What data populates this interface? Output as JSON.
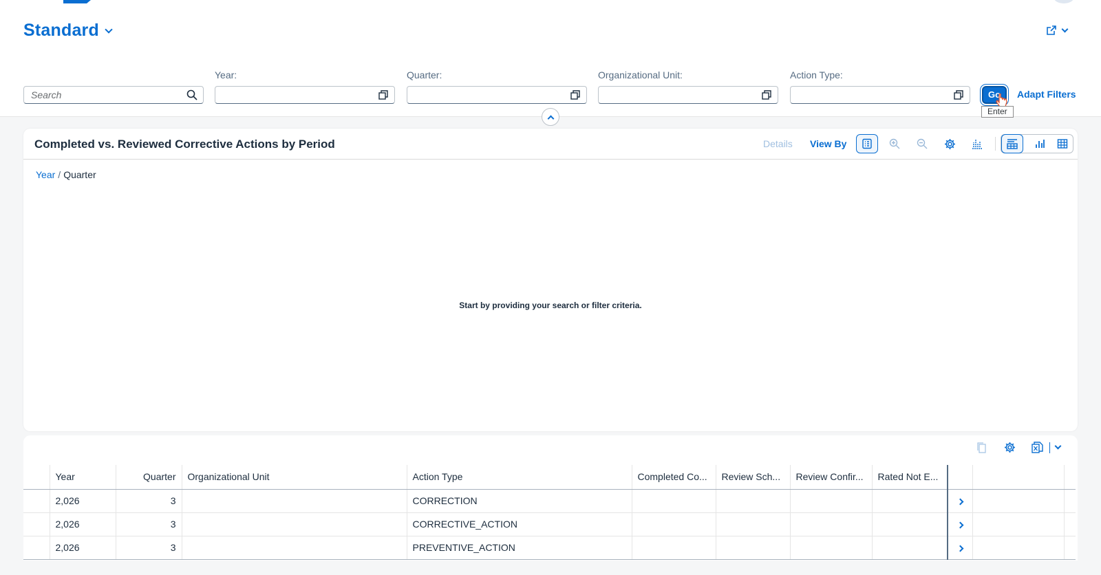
{
  "header": {
    "variant_title": "Standard",
    "filters": {
      "search_placeholder": "Search",
      "year_label": "Year:",
      "quarter_label": "Quarter:",
      "org_unit_label": "Organizational Unit:",
      "action_type_label": "Action Type:",
      "go_label": "Go",
      "go_tooltip": "Enter",
      "adapt_label": "Adapt Filters"
    }
  },
  "chart": {
    "title": "Completed vs. Reviewed Corrective Actions by Period",
    "details_label": "Details",
    "view_by_label": "View By",
    "breadcrumb": {
      "link": "Year",
      "separator": "/",
      "current": "Quarter"
    },
    "empty_message": "Start by providing your search or filter criteria."
  },
  "table": {
    "columns": [
      "Year",
      "Quarter",
      "Organizational Unit",
      "Action Type",
      "Completed Co...",
      "Review Sch...",
      "Review Confir...",
      "Rated Not E..."
    ],
    "rows": [
      {
        "year": "2,026",
        "quarter": "3",
        "org_unit": "",
        "action_type": "CORRECTION",
        "completed": "",
        "review_sch": "",
        "review_confir": "",
        "rated_not": ""
      },
      {
        "year": "2,026",
        "quarter": "3",
        "org_unit": "",
        "action_type": "CORRECTIVE_ACTION",
        "completed": "",
        "review_sch": "",
        "review_confir": "",
        "rated_not": ""
      },
      {
        "year": "2,026",
        "quarter": "3",
        "org_unit": "",
        "action_type": "PREVENTIVE_ACTION",
        "completed": "",
        "review_sch": "",
        "review_confir": "",
        "rated_not": ""
      }
    ]
  },
  "colors": {
    "accent": "#0a6ed1",
    "text": "#1d2d3e",
    "background": "#f5f6f7"
  }
}
